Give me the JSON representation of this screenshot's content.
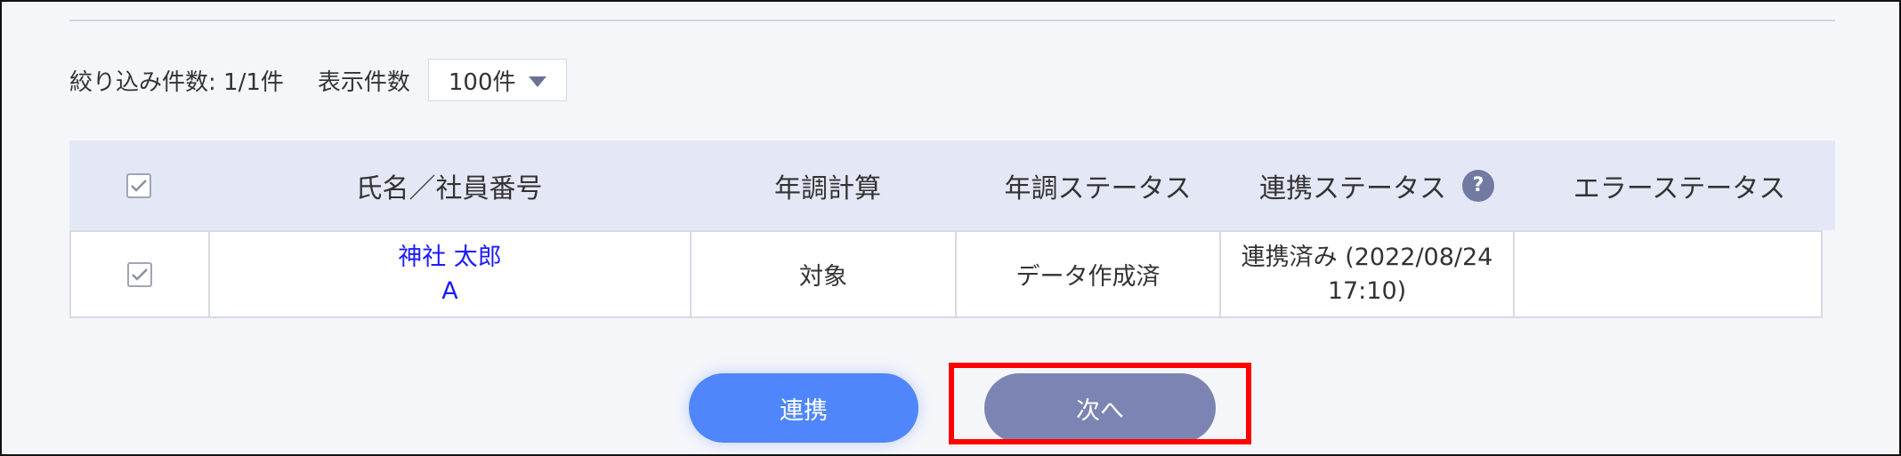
{
  "filter_bar": {
    "filter_count": "絞り込み件数: 1/1件",
    "display_count_label": "表示件数",
    "display_count_value": "100件"
  },
  "table": {
    "headers": {
      "name": "氏名／社員番号",
      "calc": "年調計算",
      "status": "年調ステータス",
      "link_status": "連携ステータス",
      "link_status_help": "?",
      "error_status": "エラーステータス"
    },
    "rows": [
      {
        "checked": true,
        "name": "神社 太郎",
        "employee_number": "A",
        "calc": "対象",
        "status": "データ作成済",
        "link_status_line1": "連携済み (2022/08/24",
        "link_status_line2": "17:10)",
        "error_status": ""
      }
    ]
  },
  "actions": {
    "link_label": "連携",
    "next_label": "次へ"
  },
  "colors": {
    "link_button": "#4f86fb",
    "next_button": "#7b84b2",
    "highlight": "#ff0000",
    "name_link": "#1b1bff"
  }
}
